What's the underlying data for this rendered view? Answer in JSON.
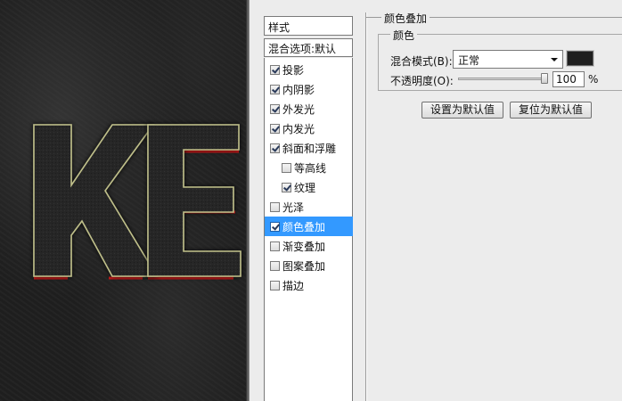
{
  "canvas": {
    "text": "KE",
    "accent_color": "#cc1a1a",
    "glow_color": "#bfbf8a"
  },
  "styles_panel": {
    "header": "样式",
    "blend_options": "混合选项:默认",
    "items": [
      {
        "label": "投影",
        "checked": true,
        "indent": false,
        "selected": false
      },
      {
        "label": "内阴影",
        "checked": true,
        "indent": false,
        "selected": false
      },
      {
        "label": "外发光",
        "checked": true,
        "indent": false,
        "selected": false
      },
      {
        "label": "内发光",
        "checked": true,
        "indent": false,
        "selected": false
      },
      {
        "label": "斜面和浮雕",
        "checked": true,
        "indent": false,
        "selected": false
      },
      {
        "label": "等高线",
        "checked": false,
        "indent": true,
        "selected": false
      },
      {
        "label": "纹理",
        "checked": true,
        "indent": true,
        "selected": false
      },
      {
        "label": "光泽",
        "checked": false,
        "indent": false,
        "selected": false
      },
      {
        "label": "颜色叠加",
        "checked": true,
        "indent": false,
        "selected": true
      },
      {
        "label": "渐变叠加",
        "checked": false,
        "indent": false,
        "selected": false
      },
      {
        "label": "图案叠加",
        "checked": false,
        "indent": false,
        "selected": false
      },
      {
        "label": "描边",
        "checked": false,
        "indent": false,
        "selected": false
      }
    ]
  },
  "options": {
    "section_title": "颜色叠加",
    "group_title": "颜色",
    "blend_mode_label": "混合模式(B):",
    "blend_mode_value": "正常",
    "overlay_color": "#1f1f1f",
    "opacity_label": "不透明度(O):",
    "opacity_value": "100",
    "opacity_unit": "%",
    "opacity_fraction": 1.0,
    "set_default_button": "设置为默认值",
    "reset_default_button": "复位为默认值"
  }
}
